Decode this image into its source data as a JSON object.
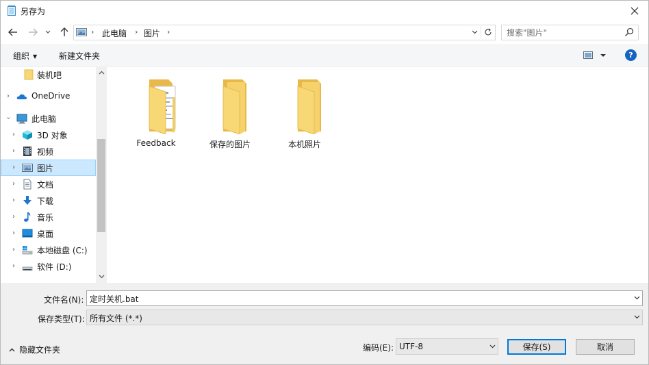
{
  "window": {
    "title": "另存为"
  },
  "address": {
    "crumbs": [
      "此电脑",
      "图片"
    ],
    "search_placeholder": "搜索\"图片\""
  },
  "toolbar": {
    "organize_label": "组织",
    "new_folder_label": "新建文件夹",
    "help_label": "?"
  },
  "nav": {
    "items": [
      {
        "label": "装机吧",
        "icon": "folder-icon"
      },
      {
        "label": "OneDrive",
        "icon": "cloud-icon"
      },
      {
        "label": "此电脑",
        "icon": "computer-icon"
      },
      {
        "label": "3D 对象",
        "icon": "cube-icon"
      },
      {
        "label": "视频",
        "icon": "video-icon"
      },
      {
        "label": "图片",
        "icon": "pictures-icon",
        "selected": true
      },
      {
        "label": "文档",
        "icon": "document-icon"
      },
      {
        "label": "下载",
        "icon": "download-icon"
      },
      {
        "label": "音乐",
        "icon": "music-icon"
      },
      {
        "label": "桌面",
        "icon": "desktop-icon"
      },
      {
        "label": "本地磁盘 (C:)",
        "icon": "drive-c-icon"
      },
      {
        "label": "软件 (D:)",
        "icon": "drive-d-icon"
      }
    ]
  },
  "folders": [
    {
      "label": "Feedback"
    },
    {
      "label": "保存的图片"
    },
    {
      "label": "本机照片"
    }
  ],
  "form": {
    "filename_label": "文件名(N):",
    "filename_value": "定时关机.bat",
    "filetype_label": "保存类型(T):",
    "filetype_value": "所有文件  (*.*)",
    "hide_folders_label": "隐藏文件夹",
    "encoding_label": "编码(E):",
    "encoding_value": "UTF-8",
    "save_label": "保存(S)",
    "cancel_label": "取消"
  },
  "colors": {
    "selection_bg": "#cce8ff",
    "accent": "#0078d7",
    "folder": "#f8d775"
  }
}
